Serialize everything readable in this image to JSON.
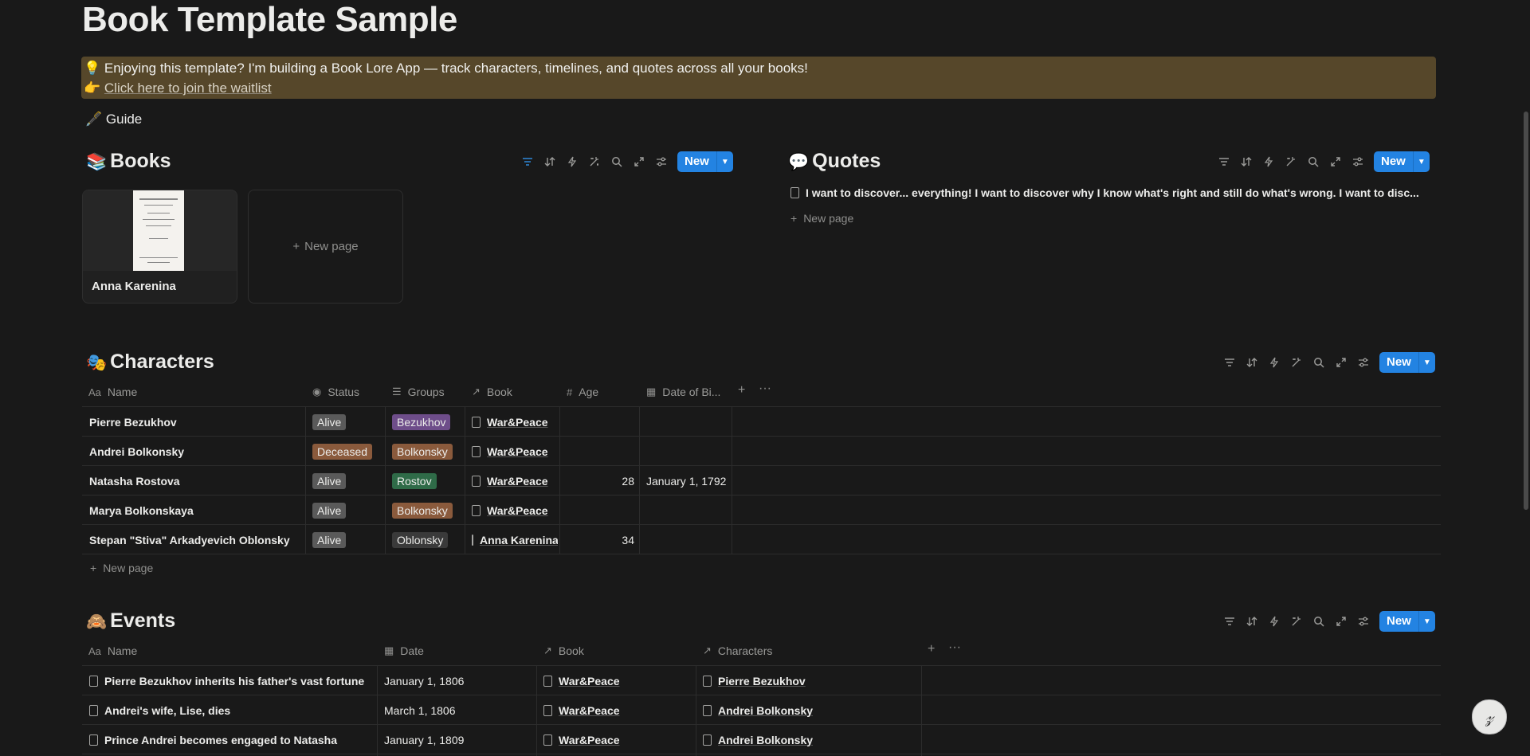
{
  "page": {
    "title": "Book Template Sample",
    "callout": {
      "line1": "💡 Enjoying this template? I'm building a Book Lore App — track characters, timelines, and quotes across all your books!",
      "line2_emoji": "👉",
      "line2_link": "Click here to join the waitlist"
    },
    "guide": "🖋️ Guide"
  },
  "toolbar": {
    "new_label": "New"
  },
  "books": {
    "emoji": "📚",
    "title": "Books",
    "cards": [
      {
        "name": "Anna Karenina"
      }
    ],
    "new_page": "New page"
  },
  "quotes": {
    "emoji": "💬",
    "title": "Quotes",
    "rows": [
      "I want to discover... everything! I want to discover why I know what's right and still do what's wrong. I want to disc..."
    ],
    "new_page": "New page"
  },
  "characters": {
    "emoji": "🎭",
    "title": "Characters",
    "columns": [
      "Name",
      "Status",
      "Groups",
      "Book",
      "Age",
      "Date of Bi..."
    ],
    "rows": [
      {
        "name": "Pierre Bezukhov",
        "status": "Alive",
        "group": "Bezukhov",
        "book": "War&Peace",
        "age": "",
        "dob": ""
      },
      {
        "name": "Andrei Bolkonsky",
        "status": "Deceased",
        "group": "Bolkonsky",
        "book": "War&Peace",
        "age": "",
        "dob": ""
      },
      {
        "name": "Natasha Rostova",
        "status": "Alive",
        "group": "Rostov",
        "book": "War&Peace",
        "age": "28",
        "dob": "January 1, 1792"
      },
      {
        "name": "Marya Bolkonskaya",
        "status": "Alive",
        "group": "Bolkonsky",
        "book": "War&Peace",
        "age": "",
        "dob": ""
      },
      {
        "name": "Stepan \"Stiva\" Arkadyevich Oblonsky",
        "status": "Alive",
        "group": "Oblonsky",
        "book": "Anna Karenina",
        "age": "34",
        "dob": ""
      }
    ],
    "new_page": "New page"
  },
  "events": {
    "emoji": "🙈",
    "title": "Events",
    "columns": [
      "Name",
      "Date",
      "Book",
      "Characters"
    ],
    "rows": [
      {
        "name": "Pierre Bezukhov inherits his father's vast fortune",
        "date": "January 1, 1806",
        "book": "War&Peace",
        "characters": "Pierre Bezukhov"
      },
      {
        "name": "Andrei's wife, Lise, dies",
        "date": "March 1, 1806",
        "book": "War&Peace",
        "characters": "Andrei Bolkonsky"
      },
      {
        "name": "Prince Andrei becomes engaged to Natasha",
        "date": "January 1, 1809",
        "book": "War&Peace",
        "characters": "Andrei Bolkonsky"
      }
    ]
  },
  "colors": {
    "accent": "#2383e2",
    "tag_alive": "#5a5a5a",
    "tag_deceased": "#8a5a3c",
    "tag_bezukhov": "#6e4d8a",
    "tag_bolkonsky": "#8a5a3c",
    "tag_rostov": "#2f6b48",
    "tag_oblonsky": "#3a3a3a"
  },
  "icons": [
    "filter-icon",
    "sort-icon",
    "automation-icon",
    "sparkle-icon",
    "search-icon",
    "expand-icon",
    "settings-icon",
    "chevron-down-icon",
    "page-icon",
    "plus-icon",
    "more-icon",
    "notion-ai-icon"
  ]
}
